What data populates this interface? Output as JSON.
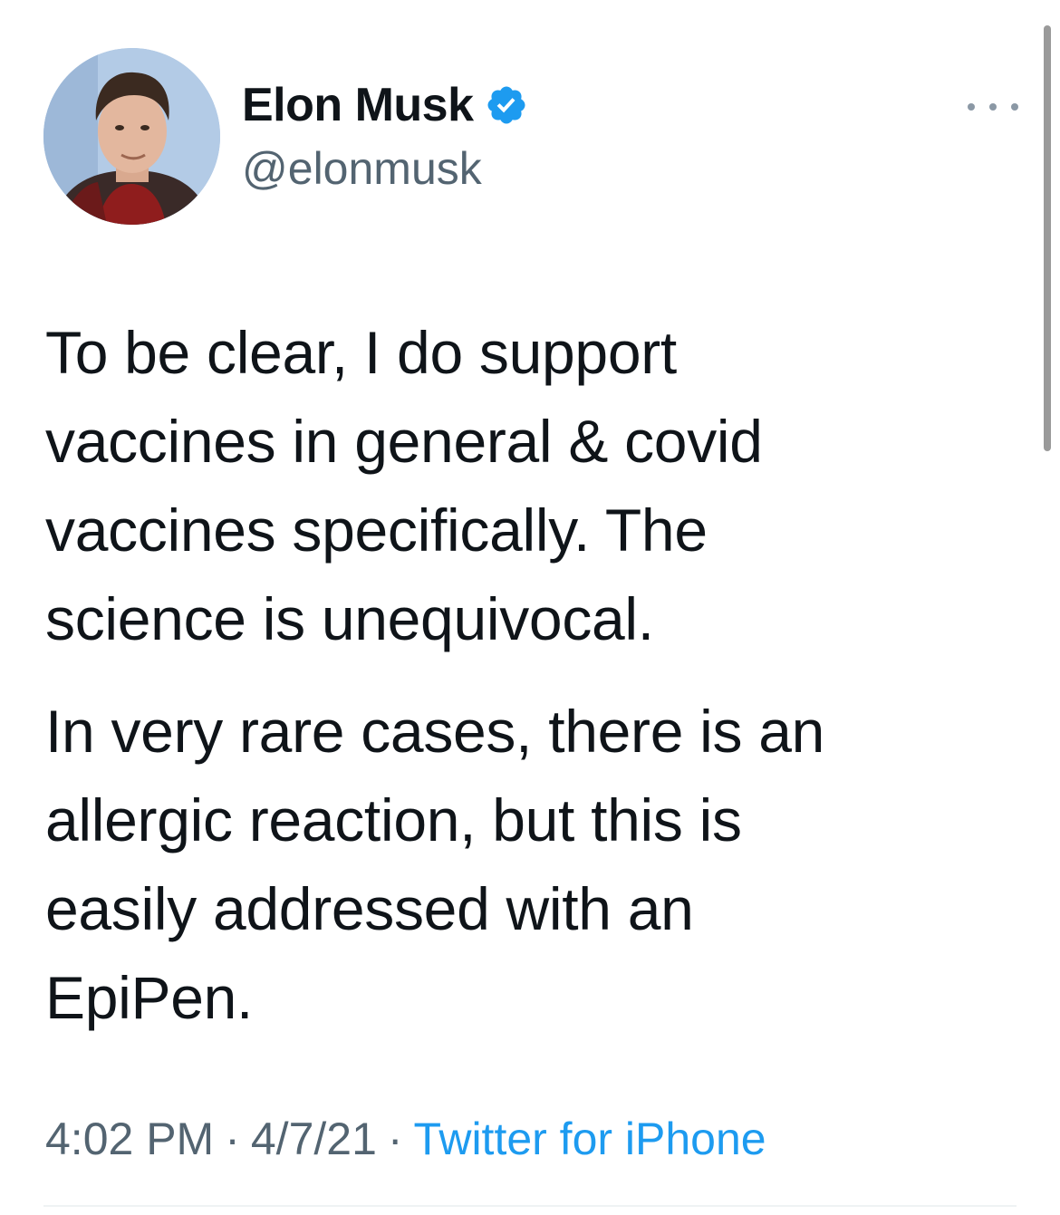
{
  "author": {
    "name": "Elon Musk",
    "handle": "@elonmusk",
    "verified": true,
    "avatar_icon": "profile-photo"
  },
  "tweet": {
    "paragraphs": [
      "To be clear, I do support\nvaccines in general & covid\nvaccines specifically. The\nscience is unequivocal.",
      "In very rare cases, there is an\nallergic reaction, but this is\neasily addressed with an\nEpiPen."
    ],
    "time": "4:02 PM",
    "date": "4/7/21",
    "separator": "·",
    "source": "Twitter for iPhone"
  },
  "colors": {
    "text": "#0f1419",
    "secondary": "#536471",
    "link": "#1d9bf0",
    "verified_badge": "#1d9bf0"
  }
}
